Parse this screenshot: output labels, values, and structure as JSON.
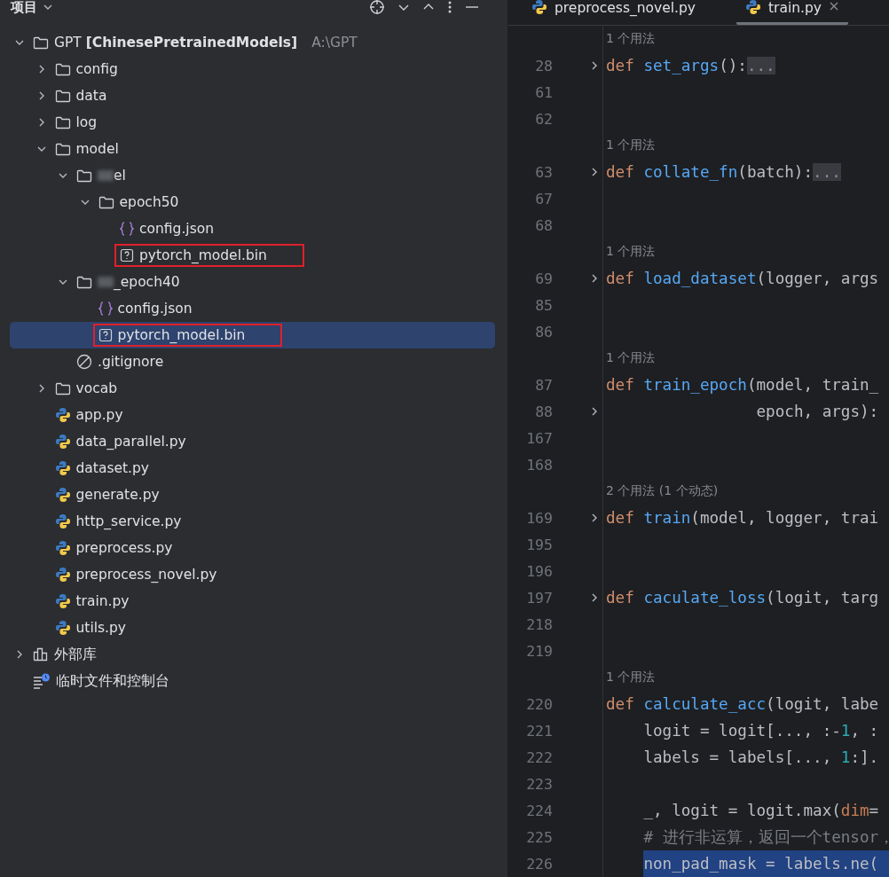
{
  "project_panel": {
    "title": "项目",
    "tree": [
      {
        "kind": "folder",
        "label": "GPT **[ChinesePretrainedModels]**",
        "path": "A:\\GPT",
        "expanded": true,
        "selected": false,
        "boxed": false,
        "children": [
          {
            "kind": "folder",
            "label": "config",
            "expanded": false,
            "selected": false,
            "boxed": false
          },
          {
            "kind": "folder",
            "label": "data",
            "expanded": false,
            "selected": false,
            "boxed": false
          },
          {
            "kind": "folder",
            "label": "log",
            "expanded": false,
            "selected": false,
            "boxed": false
          },
          {
            "kind": "folder",
            "label": "model",
            "expanded": true,
            "selected": false,
            "boxed": false,
            "children": [
              {
                "kind": "folder",
                "label": "el",
                "blurred": true,
                "expanded": true,
                "selected": false,
                "boxed": false,
                "children": [
                  {
                    "kind": "folder",
                    "label": "epoch50",
                    "expanded": true,
                    "selected": false,
                    "boxed": false,
                    "children": [
                      {
                        "kind": "json",
                        "label": "config.json",
                        "selected": false,
                        "boxed": false
                      },
                      {
                        "kind": "unknown",
                        "label": "pytorch_model.bin",
                        "selected": false,
                        "boxed": true
                      }
                    ]
                  }
                ]
              },
              {
                "kind": "folder",
                "label": "_epoch40",
                "blurred": true,
                "expanded": true,
                "selected": false,
                "boxed": false,
                "children": [
                  {
                    "kind": "json",
                    "label": "config.json",
                    "selected": false,
                    "boxed": false
                  },
                  {
                    "kind": "unknown",
                    "label": "pytorch_model.bin",
                    "selected": true,
                    "boxed": true
                  }
                ]
              },
              {
                "kind": "ignore",
                "label": ".gitignore",
                "selected": false,
                "boxed": false
              }
            ]
          },
          {
            "kind": "folder",
            "label": "vocab",
            "expanded": false,
            "selected": false,
            "boxed": false
          },
          {
            "kind": "python",
            "label": "app.py",
            "selected": false,
            "boxed": false
          },
          {
            "kind": "python",
            "label": "data_parallel.py",
            "selected": false,
            "boxed": false
          },
          {
            "kind": "python",
            "label": "dataset.py",
            "selected": false,
            "boxed": false
          },
          {
            "kind": "python",
            "label": "generate.py",
            "selected": false,
            "boxed": false
          },
          {
            "kind": "python",
            "label": "http_service.py",
            "selected": false,
            "boxed": false
          },
          {
            "kind": "python",
            "label": "preprocess.py",
            "selected": false,
            "boxed": false
          },
          {
            "kind": "python",
            "label": "preprocess_novel.py",
            "selected": false,
            "boxed": false
          },
          {
            "kind": "python",
            "label": "train.py",
            "selected": false,
            "boxed": false
          },
          {
            "kind": "python",
            "label": "utils.py",
            "selected": false,
            "boxed": false
          }
        ]
      },
      {
        "kind": "library",
        "label": "外部库",
        "expanded": false,
        "selected": false,
        "boxed": false
      },
      {
        "kind": "scratch",
        "label": "临时文件和控制台",
        "selected": false,
        "boxed": false
      }
    ]
  },
  "editor": {
    "tabs": [
      {
        "label": "preprocess_novel.py",
        "selected": false,
        "closable": false
      },
      {
        "label": "train.py",
        "selected": true,
        "closable": true
      }
    ],
    "lines": [
      {
        "kind": "hint",
        "text": "1 个用法"
      },
      {
        "kind": "code",
        "number": "28",
        "foldable": true,
        "selected": false,
        "tokens": [
          {
            "kind": "kw",
            "text": "def "
          },
          {
            "kind": "fn",
            "text": "set_args"
          },
          {
            "kind": "plain",
            "text": "():"
          },
          {
            "kind": "folded",
            "text": "..."
          }
        ]
      },
      {
        "kind": "code",
        "number": "61",
        "foldable": false,
        "selected": false
      },
      {
        "kind": "code",
        "number": "62",
        "foldable": false,
        "selected": false
      },
      {
        "kind": "hint",
        "text": "1 个用法"
      },
      {
        "kind": "code",
        "number": "63",
        "foldable": true,
        "selected": false,
        "tokens": [
          {
            "kind": "kw",
            "text": "def "
          },
          {
            "kind": "fn",
            "text": "collate_fn"
          },
          {
            "kind": "plain",
            "text": "(batch):"
          },
          {
            "kind": "folded",
            "text": "..."
          }
        ]
      },
      {
        "kind": "code",
        "number": "67",
        "foldable": false,
        "selected": false
      },
      {
        "kind": "code",
        "number": "68",
        "foldable": false,
        "selected": false
      },
      {
        "kind": "hint",
        "text": "1 个用法"
      },
      {
        "kind": "code",
        "number": "69",
        "foldable": true,
        "selected": false,
        "tokens": [
          {
            "kind": "kw",
            "text": "def "
          },
          {
            "kind": "fn",
            "text": "load_dataset"
          },
          {
            "kind": "plain",
            "text": "(logger, args"
          }
        ]
      },
      {
        "kind": "code",
        "number": "85",
        "foldable": false,
        "selected": false
      },
      {
        "kind": "code",
        "number": "86",
        "foldable": false,
        "selected": false
      },
      {
        "kind": "hint",
        "text": "1 个用法"
      },
      {
        "kind": "code",
        "number": "87",
        "foldable": false,
        "selected": false,
        "tokens": [
          {
            "kind": "kw",
            "text": "def "
          },
          {
            "kind": "fn",
            "text": "train_epoch"
          },
          {
            "kind": "plain",
            "text": "(model, train_"
          }
        ]
      },
      {
        "kind": "code",
        "number": "88",
        "foldable": true,
        "hanging": true,
        "selected": false,
        "tokens": [
          {
            "kind": "plain",
            "text": "epoch, args):"
          }
        ]
      },
      {
        "kind": "code",
        "number": "167",
        "foldable": false,
        "selected": false
      },
      {
        "kind": "code",
        "number": "168",
        "foldable": false,
        "selected": false
      },
      {
        "kind": "hint",
        "text": "2 个用法 (1 个动态)"
      },
      {
        "kind": "code",
        "number": "169",
        "foldable": true,
        "selected": false,
        "tokens": [
          {
            "kind": "kw",
            "text": "def "
          },
          {
            "kind": "fn",
            "text": "train"
          },
          {
            "kind": "plain",
            "text": "(model, logger, trai"
          }
        ]
      },
      {
        "kind": "code",
        "number": "195",
        "foldable": false,
        "selected": false
      },
      {
        "kind": "code",
        "number": "196",
        "foldable": false,
        "selected": false
      },
      {
        "kind": "code",
        "number": "197",
        "foldable": true,
        "selected": false,
        "tokens": [
          {
            "kind": "kw",
            "text": "def "
          },
          {
            "kind": "fn",
            "text": "caculate_loss"
          },
          {
            "kind": "plain",
            "text": "(logit, targ"
          }
        ]
      },
      {
        "kind": "code",
        "number": "218",
        "foldable": false,
        "selected": false
      },
      {
        "kind": "code",
        "number": "219",
        "foldable": false,
        "selected": false
      },
      {
        "kind": "hint",
        "text": "1 个用法"
      },
      {
        "kind": "code",
        "number": "220",
        "foldable": false,
        "selected": false,
        "tokens": [
          {
            "kind": "kw",
            "text": "def "
          },
          {
            "kind": "fn",
            "text": "calculate_acc"
          },
          {
            "kind": "plain",
            "text": "(logit, labe"
          }
        ]
      },
      {
        "kind": "code",
        "number": "221",
        "foldable": false,
        "indented": true,
        "selected": false,
        "tokens": [
          {
            "kind": "plain",
            "text": "logit = logit[..., :-"
          },
          {
            "kind": "num",
            "text": "1"
          },
          {
            "kind": "plain",
            "text": ", :"
          }
        ]
      },
      {
        "kind": "code",
        "number": "222",
        "foldable": false,
        "indented": true,
        "selected": false,
        "tokens": [
          {
            "kind": "plain",
            "text": "labels = labels[..., "
          },
          {
            "kind": "num",
            "text": "1"
          },
          {
            "kind": "plain",
            "text": ":]."
          }
        ]
      },
      {
        "kind": "code",
        "number": "223",
        "foldable": false,
        "selected": false
      },
      {
        "kind": "code",
        "number": "224",
        "foldable": false,
        "indented": true,
        "selected": false,
        "tokens": [
          {
            "kind": "plain",
            "text": "_, logit = logit.max("
          },
          {
            "kind": "param",
            "text": "dim"
          },
          {
            "kind": "plain",
            "text": "="
          }
        ]
      },
      {
        "kind": "code",
        "number": "225",
        "foldable": false,
        "indented": true,
        "selected": false,
        "tokens": [
          {
            "kind": "comment",
            "text": "# 进行非运算，返回一个tensor，"
          }
        ]
      },
      {
        "kind": "code",
        "number": "226",
        "foldable": false,
        "indented": true,
        "selected": true,
        "tokens": [
          {
            "kind": "plain",
            "text": "non_pad_mask = labels.ne("
          }
        ]
      }
    ]
  }
}
